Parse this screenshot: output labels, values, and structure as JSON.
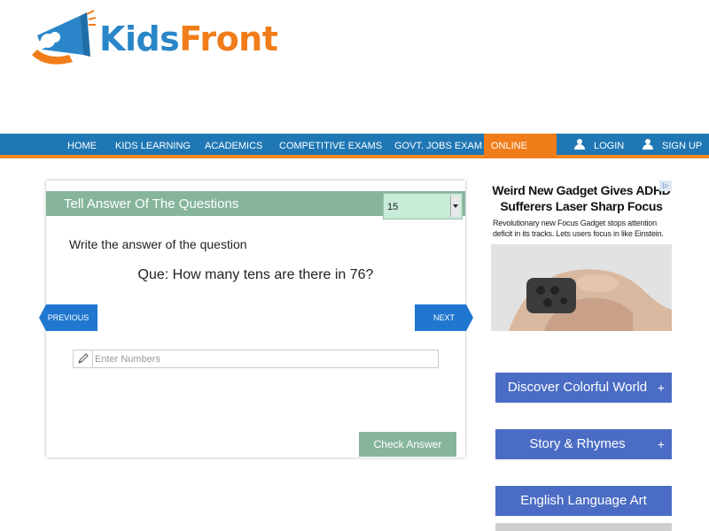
{
  "logo": {
    "part1": "Kids",
    "part2": "Front"
  },
  "nav": {
    "items": [
      "HOME",
      "KIDS LEARNING",
      "ACADEMICS",
      "COMPETITIVE EXAMS",
      "GOVT. JOBS EXAM",
      "ONLINE TEST"
    ],
    "login": "LOGIN",
    "signup": "SIGN UP"
  },
  "quiz": {
    "header_title": "Tell Answer Of The Questions",
    "selected_count": "15",
    "instruction": "Write the answer of the question",
    "question": "Que: How many tens are there in 76?",
    "prev_label": "PREVIOUS",
    "next_label": "NEXT",
    "input_placeholder": "Enter Numbers",
    "check_label": "Check Answer"
  },
  "ad": {
    "headline": "Weird New Gadget Gives ADHD Sufferers Laser Sharp Focus",
    "description": "Revolutionary new Focus Gadget stops attention deficit in its tracks. Lets users focus in like Einstein.",
    "choice_icon": "adchoices-icon"
  },
  "sidebar": {
    "buttons": [
      {
        "label": "Discover Colorful World",
        "plus": "+"
      },
      {
        "label": "Story & Rhymes",
        "plus": "+"
      },
      {
        "label": "English Language Art",
        "plus": ""
      }
    ]
  },
  "colors": {
    "nav_bg": "#1f77b4",
    "nav_accent": "#f07d1a",
    "quiz_green": "#86b59c",
    "arrow_blue": "#1f77d0",
    "side_blue": "#4a6cc4"
  }
}
